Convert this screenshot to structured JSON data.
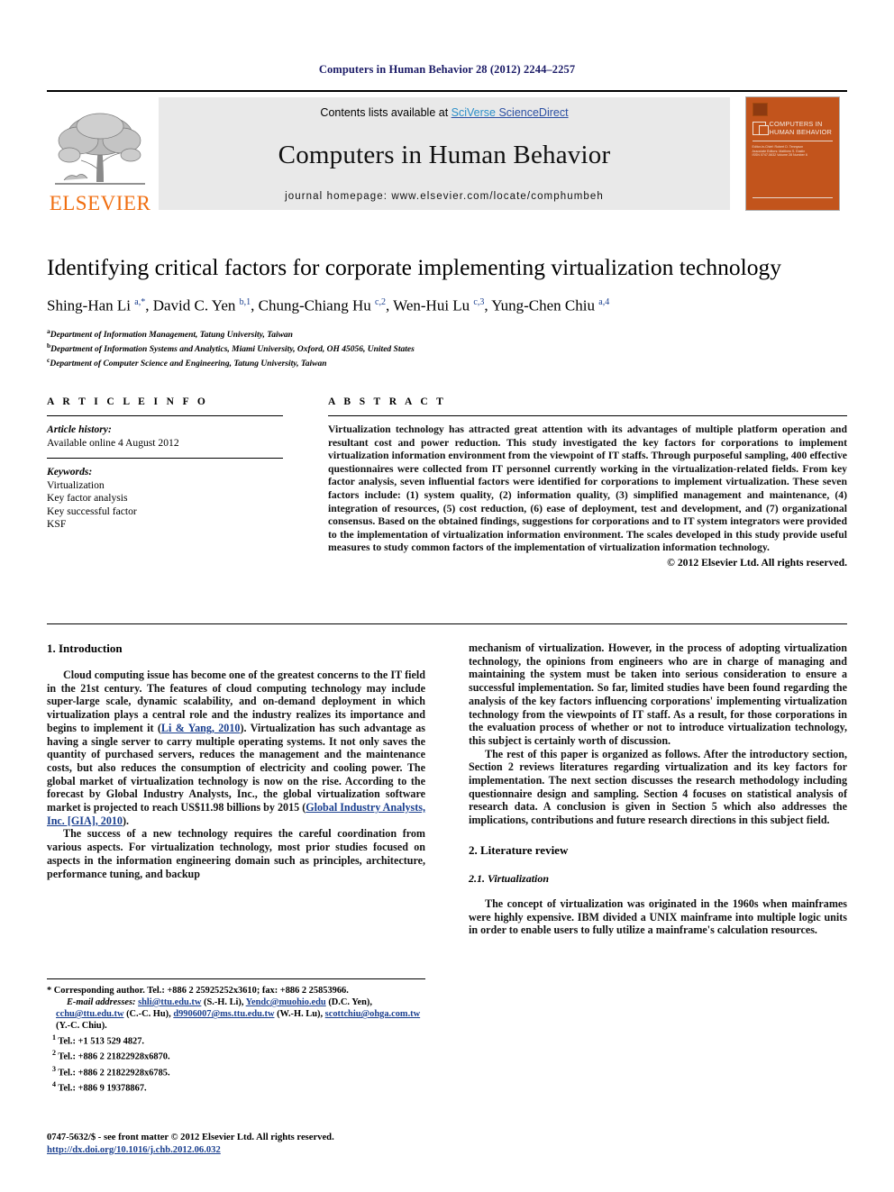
{
  "running_head": "Computers in Human Behavior 28 (2012) 2244–2257",
  "banner": {
    "publisher": "ELSEVIER",
    "contents_prefix": "Contents lists available at ",
    "contents_link_sci": "SciVerse",
    "contents_link_sd": " ScienceDirect",
    "journal_title": "Computers in Human Behavior",
    "homepage": "journal homepage: www.elsevier.com/locate/comphumbeh",
    "cover": {
      "title_line1": "COMPUTERS IN",
      "title_line2": "HUMAN BEHAVIOR",
      "sub_line1": "Editor-in-Chief: Robert D. Tennyson",
      "sub_line2": "Associate Editors: Matthew S. Eastin",
      "sub_line3": "ISSN 0747-5632    Volume 28    Number 6"
    }
  },
  "article": {
    "title": "Identifying critical factors for corporate implementing virtualization technology",
    "authors_html": "Shing-Han Li <sup>a,*</sup>, David C. Yen <sup>b,1</sup>, Chung-Chiang Hu <sup>c,2</sup>, Wen-Hui Lu <sup>c,3</sup>, Yung-Chen Chiu <sup>a,4</sup>",
    "affiliations": [
      {
        "marker": "a",
        "text": "Department of Information Management, Tatung University, Taiwan"
      },
      {
        "marker": "b",
        "text": "Department of Information Systems and Analytics, Miami University, Oxford, OH 45056, United States"
      },
      {
        "marker": "c",
        "text": "Department of Computer Science and Engineering, Tatung University, Taiwan"
      }
    ]
  },
  "article_info": {
    "heading": "A R T I C L E    I N F O",
    "history_label": "Article history:",
    "history_value": "Available online 4 August 2012",
    "keywords_label": "Keywords:",
    "keywords": [
      "Virtualization",
      "Key factor analysis",
      "Key successful factor",
      "KSF"
    ]
  },
  "abstract": {
    "heading": "A B S T R A C T",
    "text": "Virtualization technology has attracted great attention with its advantages of multiple platform operation and resultant cost and power reduction. This study investigated the key factors for corporations to implement virtualization information environment from the viewpoint of IT staffs. Through purposeful sampling, 400 effective questionnaires were collected from IT personnel currently working in the virtualization-related fields. From key factor analysis, seven influential factors were identified for corporations to implement virtualization. These seven factors include: (1) system quality, (2) information quality, (3) simplified management and maintenance, (4) integration of resources, (5) cost reduction, (6) ease of deployment, test and development, and (7) organizational consensus. Based on the obtained findings, suggestions for corporations and to IT system integrators were provided to the implementation of virtualization information environment. The scales developed in this study provide useful measures to study common factors of the implementation of virtualization information technology.",
    "copyright": "© 2012 Elsevier Ltd. All rights reserved."
  },
  "sections": {
    "intro_heading": "1. Introduction",
    "intro_p1_a": "Cloud computing issue has become one of the greatest concerns to the IT field in the 21st century. The features of cloud computing technology may include super-large scale, dynamic scalability, and on-demand deployment in which virtualization plays a central role and the industry realizes its importance and begins to implement it (",
    "intro_p1_ref1": "Li & Yang, 2010",
    "intro_p1_b": "). Virtualization has such advantage as having a single server to carry multiple operating systems. It not only saves the quantity of purchased servers, reduces the management and the maintenance costs, but also reduces the consumption of electricity and cooling power. The global market of virtualization technology is now on the rise. According to the forecast by Global Industry Analysts, Inc., the global virtualization software market is projected to reach US$11.98 billions by 2015 (",
    "intro_p1_ref2": "Global Industry Analysts, Inc. [GIA], 2010",
    "intro_p1_c": ").",
    "intro_p2": "The success of a new technology requires the careful coordination from various aspects. For virtualization technology, most prior studies focused on aspects in the information engineering domain such as principles, architecture, performance tuning, and backup",
    "intro_p3": "mechanism of virtualization. However, in the process of adopting virtualization technology, the opinions from engineers who are in charge of managing and maintaining the system must be taken into serious consideration to ensure a successful implementation. So far, limited studies have been found regarding the analysis of the key factors influencing corporations' implementing virtualization technology from the viewpoints of IT staff. As a result, for those corporations in the evaluation process of whether or not to introduce virtualization technology, this subject is certainly worth of discussion.",
    "intro_p4": "The rest of this paper is organized as follows. After the introductory section, Section 2 reviews literatures regarding virtualization and its key factors for implementation. The next section discusses the research methodology including questionnaire design and sampling. Section 4 focuses on statistical analysis of research data. A conclusion is given in Section 5 which also addresses the implications, contributions and future research directions in this subject field.",
    "lit_heading": "2. Literature review",
    "lit_sub_heading": "2.1. Virtualization",
    "lit_p1": "The concept of virtualization was originated in the 1960s when mainframes were highly expensive. IBM divided a UNIX mainframe into multiple logic units in order to enable users to fully utilize a mainframe's calculation resources."
  },
  "footnotes": {
    "corresponding_a": "* Corresponding author. Tel.: +886 2 25925252x3610; fax: +886 2 25853966.",
    "email_label": "E-mail addresses:",
    "email_1": "shli@ttu.edu.tw",
    "email_1_name": " (S.-H. Li), ",
    "email_2": "Yendc@muohio.edu",
    "email_2_name": " (D.C. Yen), ",
    "email_3": "cchu@ttu.edu.tw",
    "email_3_name": " (C.-C. Hu), ",
    "email_4": "d9906007@ms.ttu.edu.tw",
    "email_4_name": " (W.-H. Lu), ",
    "email_5": "scottchiu@ohga.com.tw",
    "email_5_name": " (Y.-C. Chiu).",
    "tels": [
      {
        "marker": "1",
        "text": "Tel.: +1 513 529 4827."
      },
      {
        "marker": "2",
        "text": "Tel.: +886 2 21822928x6870."
      },
      {
        "marker": "3",
        "text": "Tel.: +886 2 21822928x6785."
      },
      {
        "marker": "4",
        "text": "Tel.: +886 9 19378867."
      }
    ]
  },
  "imprint": {
    "front_matter": "0747-5632/$ - see front matter © 2012 Elsevier Ltd. All rights reserved.",
    "doi": "http://dx.doi.org/10.1016/j.chb.2012.06.032"
  },
  "colors": {
    "elsevier_orange": "#F06E10",
    "link_blue": "#1a3f8f",
    "running_head_navy": "#1a1a66",
    "cover_orange": "#C2541C",
    "banner_gray": "#e9e9e9"
  }
}
